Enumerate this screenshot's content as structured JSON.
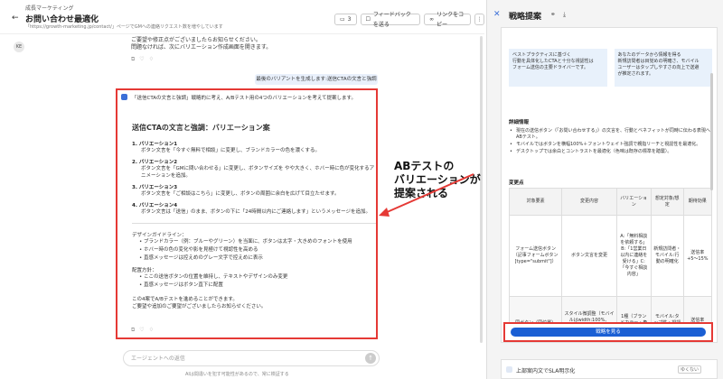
{
  "header": {
    "breadcrumb": "成長マーケティング",
    "title": "お問い合わせ最適化",
    "subtitle": "「https://growth-marketing.jp/contact/」ページでGMへの連絡リクエスト数を増やしています",
    "count_badge": "3",
    "feedback_label": "フィードバックを送る",
    "copy_link_label": "リンクをコピー"
  },
  "user_avatar": "KE",
  "prev_message": {
    "line1": "ご要望や修正点がございましたらお知らせください。",
    "line2": "問題なければ、次にバリエーション作成画面を開きます。"
  },
  "user_request": "最後のバリアントを生成します:送信CTAの文言と強調",
  "response": {
    "intro": "「送信CTAの文言と強調」戦略的に考え、A/Bテスト用の4つのバリエーションを考えて提案します。",
    "title": "送信CTAの文言と強調：バリエーション案",
    "variations": [
      {
        "head": "1. バリエーション1",
        "desc": "ボタン文言を「今すぐ無料で相談」に変更し、ブランドカラーの色を濃くする。"
      },
      {
        "head": "2. バリエーション2",
        "desc": "ボタン文言を「GMに問い合わせる」に変更し、ボタンサイズを やや大きく、ホバー時に色が変化するアニメーションを追加。"
      },
      {
        "head": "3. バリエーション3",
        "desc": "ボタン文言を「ご相談はこちら」に変更し、ボタンの周囲に余白を広げて目立たせます。"
      },
      {
        "head": "4. バリエーション4",
        "desc": "ボタン文言は「送信」のまま、ボタンの下に「24時間以内にご連絡します」というメッセージを追加。"
      }
    ],
    "guide_title": "デザインガイドライン：",
    "guide_items": [
      "ブランドカラー（例：ブルーやグリーン）を当面に、ボタンは太字・大きめのフォントを使用",
      "ホバー時の色の変化や影を見極けて視認性を高める",
      "直感メッセージは控えめのグレー文字で控えめに表示"
    ],
    "place_title": "配置方針：",
    "place_items": [
      "ここの送信ボタンの位置を維持し、テキストやデザインのみ変更",
      "直感メッセージはボタン直下に配置"
    ],
    "closing1": "この4案でA/Bテストを進めることができます。",
    "closing2": "ご要望や追加のご要望がございましたらお知らせください。"
  },
  "input": {
    "placeholder": "エージェントへの返信",
    "send_icon": "arrow-up-icon"
  },
  "disclaimer": "AIは間違いを犯す可能性があるので、常に検証する",
  "annotation": {
    "line1": "ABテストの",
    "line2": "バリエーションが",
    "line3": "提案される"
  },
  "panel": {
    "title": "戦略提案",
    "box_left": {
      "line1": "ベストプラクティスに基づく",
      "line2": "行動を具体化したCTAと十分な視認性は",
      "line3": "フォーム送信の主要ドライバーです。"
    },
    "box_right": {
      "line1": "あなたのデータから情報を得る",
      "line2": "新規訪問者は目覚めの明確さ、モバイル",
      "line3": "ユーザーはタップしやすさの向上で送避",
      "line4": "が推定されます。"
    },
    "detail_title": "詳細情報",
    "detail_items": [
      "現在の送信ボタン（「お問い合わせする」）の文言を、行動とベネフィットが同時に伝わる表現へABテスト。",
      "モバイルではボタンを横幅100%＋フォントウェイト強調で親指リーチと視認性を最適化。",
      "デスクトップでは余白とコントラストを最適化（色味は既存の標準を踏襲）。"
    ],
    "change_title": "変更点",
    "table": {
      "headers": [
        "対象要素",
        "変更内容",
        "バリエーション",
        "想定対象/想定",
        "期待効果"
      ],
      "row1": [
        "フォーム送信ボタン（記事フォームボタン[type=\"submit\"]）",
        "ボタン文言を変更",
        "A:「無料相談を依頼する」B:「1営業日以内に連絡を受ける」C:「今すぐ相談内容」",
        "新規訪問者・モバイル:行動の明確化",
        "送信率+5〜15%"
      ],
      "row2": [
        "同ボタン（同位置）",
        "スタイル微調整（モバイルはwidth:100%、font-weight:600、わずかな影／ホバー強調）",
        "1種（ブランドカラー・角丸は踏襲）",
        "モバイル:タップ性・視認性向上",
        "送信率+2〜6%"
      ]
    },
    "cta_label": "戦略を見る",
    "next_title": "上部案内文でSLA明示化",
    "next_badge": "ゆくない"
  }
}
